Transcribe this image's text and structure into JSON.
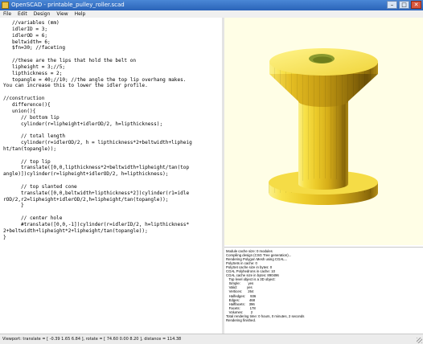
{
  "window": {
    "title": "OpenSCAD - printable_pulley_roller.scad"
  },
  "menu": [
    "File",
    "Edit",
    "Design",
    "View",
    "Help"
  ],
  "editor": {
    "code": "   //variables (mm)\n   idlerID = 3;\n   idlerOD = 6;\n   beltwidth= 6;\n   $fn=30; //faceting\n\n   //these are the lips that hold the belt on\n   lipheight = 3;//5;\n   lipthickness = 2;\n   topangle = 40;//10; //the angle the top lip overhang makes.\nYou can increase this to lower the idler profile.\n\n//construction\n   difference(){\n   union(){\n      // bottom lip\n      cylinder(r=lipheight+idlerOD/2, h=lipthickness);\n\n      // total length\n      cylinder(r=idlerOD/2, h = lipthickness*2+beltwidth+lipheig\nht/tan(topangle));\n\n      // top lip\n      translate([0,0,lipthickness*2+beltwidth+lipheight/tan(top\nangle)])cylinder(r=lipheight+idlerOD/2, h=lipthickness);\n\n      // top slanted cone\n      translate([0,0,beltwidth+lipthickness*2])cylinder(r1=idle\nrOD/2,r2=lipheight+idlerOD/2,h=lipheight/tan(topangle));\n      }\n\n      // center hole\n      #translate([0,0,-1])cylinder(r=idlerID/2, h=lipthickness*\n2+beltwidth+lipheight*2+lipheight/tan(topangle));\n}"
  },
  "console": {
    "text": "Module cache size: 0 modules\nCompiling design (CSG Tree generation)...\nRendering Polygon Mesh using CGAL...\nPolySets in cache: 0\nPolySet cache size in bytes: 0\nCGAL Polyhedrons in cache: 10\nCGAL cache size in bytes: 890496\n   Top level object is a 3D object:\n   Simple:        yes\n   Valid:          yes\n   Vertices:      264\n   Halfedges:     936\n   Edges:          468\n   Halffacets:    396\n   Facets:          178\n   Volumes:        2\nTotal rendering time: 0 hours, 0 minutes, 2 seconds\nRendering finished."
  },
  "status": {
    "text": "Viewport: translate = [ -0.39 1.65 6.84 ], rotate = [ 74.60 0.00 8.20 ], distance = 114.38"
  },
  "colors": {
    "viewport_bg": "#fffee6",
    "model_base": "#f2cf32",
    "hole": "#8a9a2e"
  },
  "icons": [
    "app-icon",
    "minimize-icon",
    "maximize-icon",
    "close-icon",
    "resize-grip-icon"
  ]
}
